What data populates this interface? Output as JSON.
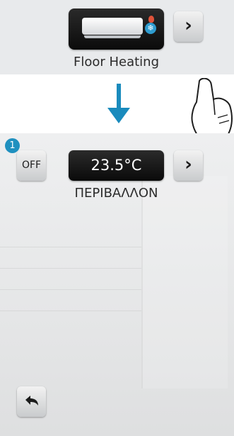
{
  "top": {
    "device_name": "Floor Heating",
    "device_icon": "air-conditioner-icon",
    "next_icon": "chevron-right-icon",
    "next_glyph": "›"
  },
  "transition": {
    "icon": "arrow-down-icon",
    "color": "#1a8bbd"
  },
  "bottom": {
    "badge": "1",
    "off_label": "OFF",
    "temperature": "23.5°C",
    "zone_name": "ΠΕΡΙΒΑΛΛΟΝ",
    "next_glyph": "›",
    "back_icon": "back-arrow-icon"
  }
}
